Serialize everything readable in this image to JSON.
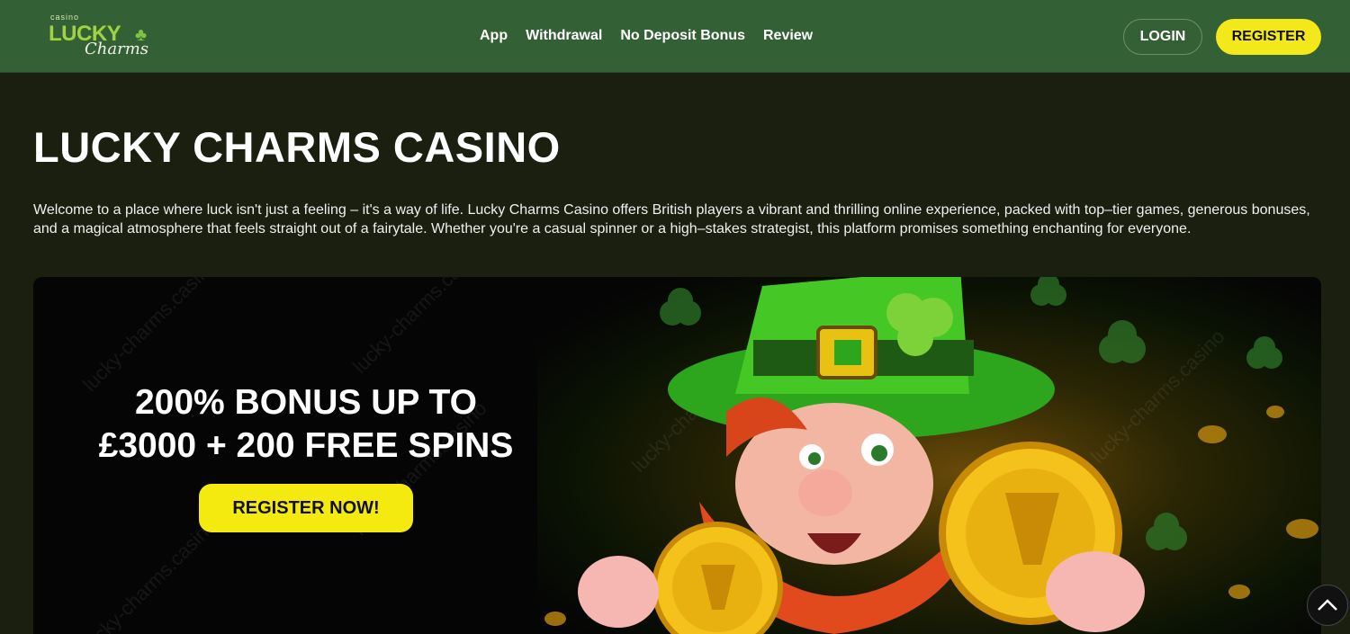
{
  "logo": {
    "small": "casino",
    "word1": "LUCKY",
    "word2": "Charms"
  },
  "nav": [
    "App",
    "Withdrawal",
    "No Deposit Bonus",
    "Review"
  ],
  "header_buttons": {
    "login": "LOGIN",
    "register": "REGISTER"
  },
  "page": {
    "title": "LUCKY CHARMS CASINO",
    "intro": "Welcome to a place where luck isn't just a feeling – it's a way of life. Lucky Charms Casino offers British players a vibrant and thrilling online experience, packed with top–tier games, generous bonuses, and a magical atmosphere that feels straight out of a fairytale. Whether you're a casual spinner or a high–stakes strategist, this platform promises something enchanting for everyone."
  },
  "banner": {
    "line1": "200% BONUS UP TO",
    "line2": "£3000 + 200 FREE SPINS",
    "cta": "REGISTER NOW!",
    "watermark": "lucky-charms.casino"
  },
  "colors": {
    "header_bg": "#346036",
    "page_bg": "#1a1f0f",
    "accent_yellow": "#f2e81a",
    "hat_green": "#3fbf1f"
  },
  "icons": {
    "clover": "clover-icon",
    "scroll_top": "chevron-up-icon"
  }
}
